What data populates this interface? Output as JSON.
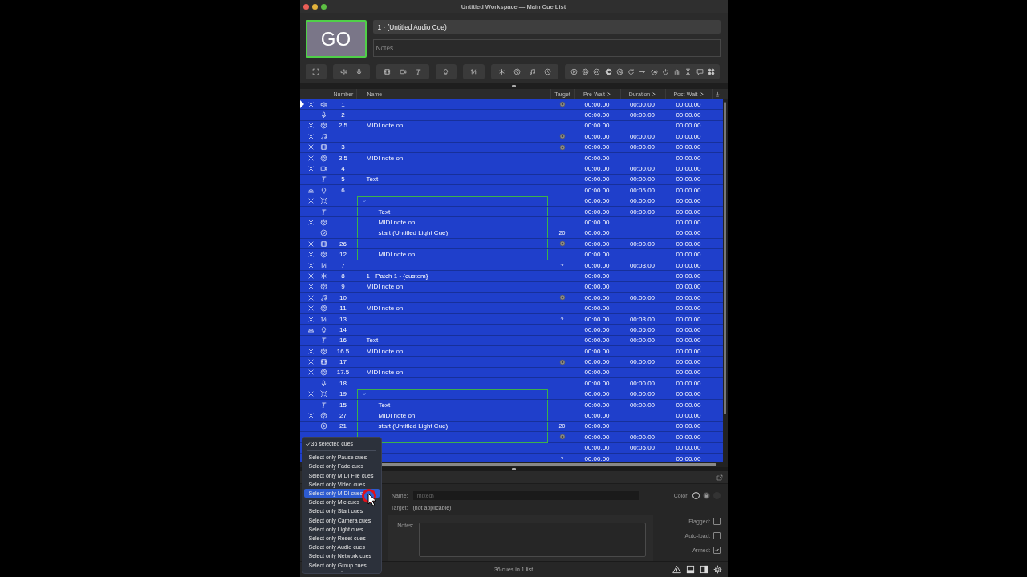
{
  "window": {
    "title": "Untitled Workspace — Main Cue List"
  },
  "go_button": {
    "label": "GO"
  },
  "cue_name": {
    "value": "1 · (Untitled Audio Cue)"
  },
  "notes": {
    "placeholder": "Notes"
  },
  "columns": [
    {
      "label": "Number",
      "arrow": false
    },
    {
      "label": "Name",
      "arrow": false
    },
    {
      "label": "Target",
      "arrow": false
    },
    {
      "label": "Pre-Wait",
      "arrow": true
    },
    {
      "label": "Duration",
      "arrow": true
    },
    {
      "label": "Post-Wait",
      "arrow": true
    }
  ],
  "rows": [
    {
      "status": {
        "kind": "broken"
      },
      "kind": "audio",
      "number": "1",
      "target_icon": {
        "kind": "disc"
      },
      "pre": "00:00.00",
      "duration": "00:00.00",
      "post": "00:00.00",
      "selected": true,
      "playhead": true
    },
    {
      "kind": "mic",
      "number": "2",
      "pre": "00:00.00",
      "duration": "00:00.00",
      "post": "00:00.00",
      "selected": true,
      "playhead": false
    },
    {
      "status": {
        "kind": "broken"
      },
      "kind": "midi",
      "number": "2.5",
      "name": "MIDI note on",
      "pre": "00:00.00",
      "post": "00:00.00",
      "selected": true,
      "playhead": false
    },
    {
      "status": {
        "kind": "broken"
      },
      "kind": "music",
      "target_icon": {
        "kind": "disc"
      },
      "pre": "00:00.00",
      "duration": "00:00.00",
      "post": "00:00.00",
      "selected": true,
      "playhead": false
    },
    {
      "status": {
        "kind": "broken"
      },
      "kind": "video",
      "number": "3",
      "target_icon": {
        "kind": "disc"
      },
      "pre": "00:00.00",
      "duration": "00:00.00",
      "post": "00:00.00",
      "selected": true,
      "playhead": false
    },
    {
      "status": {
        "kind": "broken"
      },
      "kind": "midi",
      "number": "3.5",
      "name": "MIDI note on",
      "pre": "00:00.00",
      "post": "00:00.00",
      "selected": true,
      "playhead": false
    },
    {
      "status": {
        "kind": "broken"
      },
      "kind": "camera",
      "number": "4",
      "pre": "00:00.00",
      "duration": "00:00.00",
      "post": "00:00.00",
      "selected": true,
      "playhead": false
    },
    {
      "kind": "text",
      "number": "5",
      "name": "Text",
      "pre": "00:00.00",
      "duration": "00:00.00",
      "post": "00:00.00",
      "selected": true,
      "playhead": false
    },
    {
      "status": {
        "kind": "warning"
      },
      "kind": "light",
      "number": "6",
      "pre": "00:00.00",
      "duration": "00:05.00",
      "post": "00:00.00",
      "selected": true,
      "playhead": false
    },
    {
      "status": {
        "kind": "broken"
      },
      "kind": "group",
      "expanded": true,
      "pre": "00:00.00",
      "duration": "00:00.00",
      "post": "00:00.00",
      "selected": true,
      "playhead": false,
      "children": [
        {
          "kind": "text",
          "name": "Text",
          "pre": "00:00.00",
          "duration": "00:00.00",
          "post": "00:00.00",
          "selected": true,
          "playhead": false
        },
        {
          "status": {
            "kind": "broken"
          },
          "kind": "midi",
          "name": "MIDI note on",
          "pre": "00:00.00",
          "post": "00:00.00",
          "selected": true,
          "playhead": false
        },
        {
          "kind": "start",
          "name": "start (Untitled Light Cue)",
          "target": "20",
          "pre": "00:00.00",
          "post": "00:00.00",
          "selected": true,
          "playhead": false
        },
        {
          "status": {
            "kind": "broken"
          },
          "kind": "video",
          "number": "26",
          "target_icon": {
            "kind": "disc"
          },
          "pre": "00:00.00",
          "duration": "00:00.00",
          "post": "00:00.00",
          "selected": true,
          "playhead": false
        },
        {
          "status": {
            "kind": "broken"
          },
          "kind": "midi",
          "number": "12",
          "name": "MIDI note on",
          "pre": "00:00.00",
          "post": "00:00.00",
          "selected": true,
          "playhead": false
        }
      ]
    },
    {
      "status": {
        "kind": "broken"
      },
      "kind": "fade",
      "number": "7",
      "target": "?",
      "pre": "00:00.00",
      "duration": "00:03.00",
      "post": "00:00.00",
      "selected": true,
      "playhead": false
    },
    {
      "status": {
        "kind": "broken"
      },
      "kind": "network",
      "number": "8",
      "name": "1 · Patch 1 - {custom}",
      "pre": "00:00.00",
      "post": "00:00.00",
      "selected": true,
      "playhead": false
    },
    {
      "status": {
        "kind": "broken"
      },
      "kind": "midi",
      "number": "9",
      "name": "MIDI note on",
      "pre": "00:00.00",
      "post": "00:00.00",
      "selected": true,
      "playhead": false
    },
    {
      "status": {
        "kind": "broken"
      },
      "kind": "music",
      "number": "10",
      "target_icon": {
        "kind": "disc"
      },
      "pre": "00:00.00",
      "duration": "00:00.00",
      "post": "00:00.00",
      "selected": true,
      "playhead": false
    },
    {
      "status": {
        "kind": "broken"
      },
      "kind": "midi",
      "number": "11",
      "name": "MIDI note on",
      "pre": "00:00.00",
      "post": "00:00.00",
      "selected": true,
      "playhead": false
    },
    {
      "status": {
        "kind": "broken"
      },
      "kind": "fade",
      "number": "13",
      "target": "?",
      "pre": "00:00.00",
      "duration": "00:03.00",
      "post": "00:00.00",
      "selected": true,
      "playhead": false
    },
    {
      "status": {
        "kind": "warning"
      },
      "kind": "light",
      "number": "14",
      "pre": "00:00.00",
      "duration": "00:05.00",
      "post": "00:00.00",
      "selected": true,
      "playhead": false
    },
    {
      "kind": "text",
      "number": "16",
      "name": "Text",
      "pre": "00:00.00",
      "duration": "00:00.00",
      "post": "00:00.00",
      "selected": true,
      "playhead": false
    },
    {
      "status": {
        "kind": "broken"
      },
      "kind": "midi",
      "number": "16.5",
      "name": "MIDI note on",
      "pre": "00:00.00",
      "post": "00:00.00",
      "selected": true,
      "playhead": false
    },
    {
      "status": {
        "kind": "broken"
      },
      "kind": "video",
      "number": "17",
      "target_icon": {
        "kind": "disc"
      },
      "pre": "00:00.00",
      "duration": "00:00.00",
      "post": "00:00.00",
      "selected": true,
      "playhead": false
    },
    {
      "status": {
        "kind": "broken"
      },
      "kind": "midi",
      "number": "17.5",
      "name": "MIDI note on",
      "pre": "00:00.00",
      "post": "00:00.00",
      "selected": true,
      "playhead": false
    },
    {
      "kind": "mic",
      "number": "18",
      "pre": "00:00.00",
      "duration": "00:00.00",
      "post": "00:00.00",
      "selected": true,
      "playhead": false
    },
    {
      "status": {
        "kind": "broken"
      },
      "kind": "group",
      "number": "19",
      "expanded": true,
      "pre": "00:00.00",
      "duration": "00:00.00",
      "post": "00:00.00",
      "selected": true,
      "playhead": false,
      "children": [
        {
          "kind": "text",
          "number": "15",
          "name": "Text",
          "pre": "00:00.00",
          "duration": "00:00.00",
          "post": "00:00.00",
          "selected": true,
          "playhead": false
        },
        {
          "status": {
            "kind": "broken"
          },
          "kind": "midi",
          "number": "27",
          "name": "MIDI note on",
          "pre": "00:00.00",
          "post": "00:00.00",
          "selected": true,
          "playhead": false
        },
        {
          "kind": "start",
          "number": "21",
          "name": "start (Untitled Light Cue)",
          "target": "20",
          "pre": "00:00.00",
          "post": "00:00.00",
          "selected": true,
          "playhead": false
        },
        {
          "target_icon": {
            "kind": "disc"
          },
          "pre": "00:00.00",
          "duration": "00:00.00",
          "post": "00:00.00",
          "selected": true,
          "playhead": false
        }
      ]
    },
    {
      "pre": "00:00.00",
      "duration": "00:05.00",
      "post": "00:00.00",
      "selected": true,
      "playhead": false
    },
    {
      "target": "?",
      "pre": "00:00.00",
      "post": "00:00.00",
      "selected": true,
      "playhead": false
    }
  ],
  "menu": {
    "items": [
      {
        "kind": "summary",
        "label": "36 selected cues",
        "checked": true,
        "selected": false
      },
      {
        "kind": "option",
        "label": "Select only Pause cues",
        "checked": false,
        "selected": false
      },
      {
        "kind": "option",
        "label": "Select only Fade cues",
        "checked": false,
        "selected": false
      },
      {
        "kind": "option",
        "label": "Select only MIDI File cues",
        "checked": false,
        "selected": false
      },
      {
        "kind": "option",
        "label": "Select only Video cues",
        "checked": false,
        "selected": false
      },
      {
        "kind": "option",
        "label": "Select only MIDI cues",
        "checked": false,
        "selected": true
      },
      {
        "kind": "option",
        "label": "Select only Mic cues",
        "checked": false,
        "selected": false
      },
      {
        "kind": "option",
        "label": "Select only Start cues",
        "checked": false,
        "selected": false
      },
      {
        "kind": "option",
        "label": "Select only Camera cues",
        "checked": false,
        "selected": false
      },
      {
        "kind": "option",
        "label": "Select only Light cues",
        "checked": false,
        "selected": false
      },
      {
        "kind": "option",
        "label": "Select only Reset cues",
        "checked": false,
        "selected": false
      },
      {
        "kind": "option",
        "label": "Select only Audio cues",
        "checked": false,
        "selected": false
      },
      {
        "kind": "option",
        "label": "Select only Network cues",
        "checked": false,
        "selected": false
      },
      {
        "kind": "option",
        "label": "Select only Group cues",
        "checked": false,
        "selected": false
      }
    ]
  },
  "inspector": {
    "name_label": "Name:",
    "name": {
      "placeholder": "(mixed)"
    },
    "target_label": "Target:",
    "target": "(not applicable)",
    "notes_label": "Notes:",
    "color_label": "Color:",
    "checkboxes": [
      {
        "label": "Flagged:",
        "checked": false
      },
      {
        "label": "Auto-load:",
        "checked": false
      },
      {
        "label": "Armed:",
        "checked": true
      }
    ]
  },
  "status_bar": {
    "text": "36 cues in 1 list"
  }
}
